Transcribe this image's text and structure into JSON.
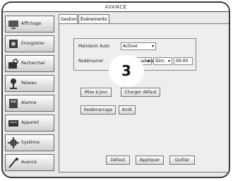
{
  "window": {
    "title": "AVANCÉ"
  },
  "sidebar": {
    "items": [
      {
        "label": "Affichage",
        "icon": "display-icon"
      },
      {
        "label": "Enregistrer",
        "icon": "record-icon"
      },
      {
        "label": "Rechercher",
        "icon": "search-icon"
      },
      {
        "label": "Réseau",
        "icon": "network-icon"
      },
      {
        "label": "Alarme",
        "icon": "alarm-icon"
      },
      {
        "label": "Appareil",
        "icon": "device-icon"
      },
      {
        "label": "Système",
        "icon": "gear-icon"
      },
      {
        "label": "Avancé",
        "icon": "advanced-icon"
      }
    ]
  },
  "tabs": [
    {
      "label": "Gestion"
    },
    {
      "label": "Événements"
    }
  ],
  "settings": {
    "maintenir_label": "Maintenir Auto",
    "maintenir_value": "Activer",
    "redemarrer_label": "Redémarrer",
    "frequency_value": "Hebdomadaire",
    "day_value": "Dim.",
    "time_value": "00:00"
  },
  "buttons": {
    "mise_a_jour": "Mise à Jour",
    "charger_defaut": "Charger défaut",
    "redemarrage": "Redémarrage",
    "arret": "Arrêt",
    "defaut": "Défaut",
    "appliquer": "Appliquer",
    "quitter": "Quitter"
  },
  "callout": {
    "number": "3"
  }
}
